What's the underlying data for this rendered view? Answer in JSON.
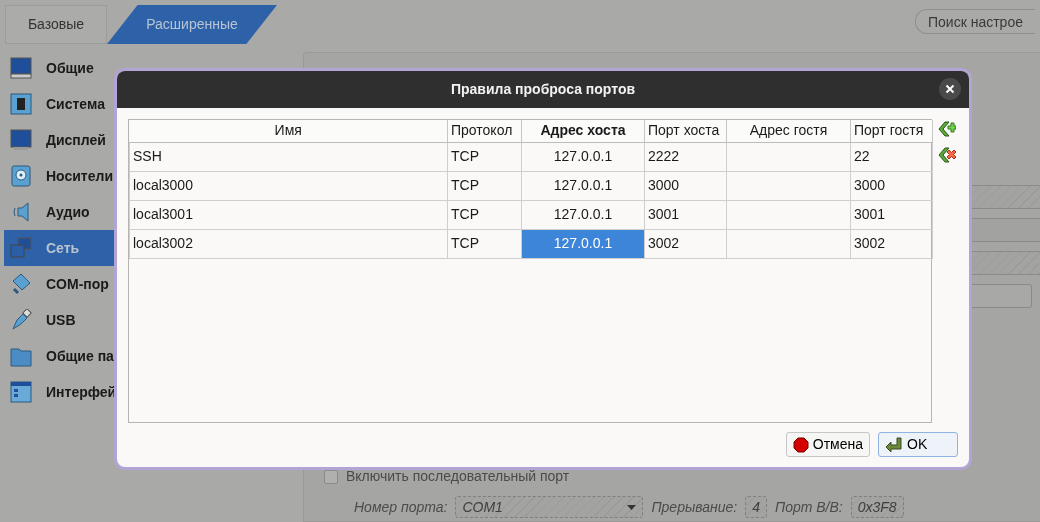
{
  "tabs": [
    {
      "label": "Базовые",
      "selected": false
    },
    {
      "label": "Расширенные",
      "selected": true
    }
  ],
  "search": {
    "placeholder": "Поиск настрое"
  },
  "sidebar": {
    "items": [
      {
        "label": "Общие",
        "selected": false
      },
      {
        "label": "Система",
        "selected": false
      },
      {
        "label": "Дисплей",
        "selected": false
      },
      {
        "label": "Носители",
        "selected": false
      },
      {
        "label": "Аудио",
        "selected": false
      },
      {
        "label": "Сеть",
        "selected": true
      },
      {
        "label": "COM-пор",
        "selected": false
      },
      {
        "label": "USB",
        "selected": false
      },
      {
        "label": "Общие па",
        "selected": false
      },
      {
        "label": "Интерфей",
        "selected": false
      }
    ]
  },
  "serial_port": {
    "enable": {
      "label": "Включить последовательный порт",
      "checked": false
    },
    "fields": [
      {
        "label": "Номер порта:",
        "value": "COM1",
        "kind": "combo"
      },
      {
        "label": "Прерывание:",
        "value": "4",
        "kind": "text"
      },
      {
        "label": "Порт В/В:",
        "value": "0x3F8",
        "kind": "text"
      }
    ]
  },
  "dialog": {
    "title": "Правила проброса портов",
    "table": {
      "columns": [
        {
          "label": "Имя",
          "sorted": false
        },
        {
          "label": "Протокол",
          "sorted": false
        },
        {
          "label": "Адрес хоста",
          "sorted": true
        },
        {
          "label": "Порт хоста",
          "sorted": false
        },
        {
          "label": "Адрес гостя",
          "sorted": false
        },
        {
          "label": "Порт гостя",
          "sorted": false
        }
      ],
      "rows": [
        {
          "cells": [
            {
              "text": "SSH",
              "selected": false
            },
            {
              "text": "TCP",
              "selected": false
            },
            {
              "text": "127.0.0.1",
              "selected": false
            },
            {
              "text": "2222",
              "selected": false
            },
            {
              "selected": false
            },
            {
              "text": "22",
              "selected": false
            }
          ]
        },
        {
          "cells": [
            {
              "text": "local3000",
              "selected": false
            },
            {
              "text": "TCP",
              "selected": false
            },
            {
              "text": "127.0.0.1",
              "selected": false
            },
            {
              "text": "3000",
              "selected": false
            },
            {
              "selected": false
            },
            {
              "text": "3000",
              "selected": false
            }
          ]
        },
        {
          "cells": [
            {
              "text": "local3001",
              "selected": false
            },
            {
              "text": "TCP",
              "selected": false
            },
            {
              "text": "127.0.0.1",
              "selected": false
            },
            {
              "text": "3001",
              "selected": false
            },
            {
              "selected": false
            },
            {
              "text": "3001",
              "selected": false
            }
          ]
        },
        {
          "cells": [
            {
              "text": "local3002",
              "selected": false
            },
            {
              "text": "TCP",
              "selected": false
            },
            {
              "text": "127.0.0.1",
              "selected": true
            },
            {
              "text": "3002",
              "selected": false
            },
            {
              "selected": false
            },
            {
              "text": "3002",
              "selected": false
            }
          ]
        }
      ]
    },
    "buttons": [
      {
        "label": "Отмена",
        "kind": "cancel",
        "default": false
      },
      {
        "label": "OK",
        "kind": "ok",
        "default": true
      }
    ]
  }
}
